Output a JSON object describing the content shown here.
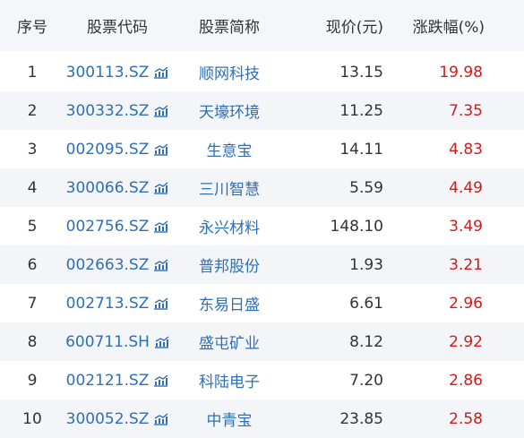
{
  "colors": {
    "link": "#2e6fb7",
    "up": "#d01b1b",
    "text": "#333333",
    "header_bg": "#f4f6f9",
    "stripe_bg": "#f3f5f8"
  },
  "header": {
    "index": "序号",
    "code": "股票代码",
    "name": "股票简称",
    "price": "现价(元)",
    "change": "涨跌幅(%)"
  },
  "icons": {
    "chart": "trend-chart-icon"
  },
  "rows": [
    {
      "index": "1",
      "code": "300113.SZ",
      "name": "顺网科技",
      "price": "13.15",
      "change": "19.98"
    },
    {
      "index": "2",
      "code": "300332.SZ",
      "name": "天壕环境",
      "price": "11.25",
      "change": "7.35"
    },
    {
      "index": "3",
      "code": "002095.SZ",
      "name": "生意宝",
      "price": "14.11",
      "change": "4.83"
    },
    {
      "index": "4",
      "code": "300066.SZ",
      "name": "三川智慧",
      "price": "5.59",
      "change": "4.49"
    },
    {
      "index": "5",
      "code": "002756.SZ",
      "name": "永兴材料",
      "price": "148.10",
      "change": "3.49"
    },
    {
      "index": "6",
      "code": "002663.SZ",
      "name": "普邦股份",
      "price": "1.93",
      "change": "3.21"
    },
    {
      "index": "7",
      "code": "002713.SZ",
      "name": "东易日盛",
      "price": "6.61",
      "change": "2.96"
    },
    {
      "index": "8",
      "code": "600711.SH",
      "name": "盛屯矿业",
      "price": "8.12",
      "change": "2.92"
    },
    {
      "index": "9",
      "code": "002121.SZ",
      "name": "科陆电子",
      "price": "7.20",
      "change": "2.86"
    },
    {
      "index": "10",
      "code": "300052.SZ",
      "name": "中青宝",
      "price": "23.85",
      "change": "2.58"
    }
  ]
}
